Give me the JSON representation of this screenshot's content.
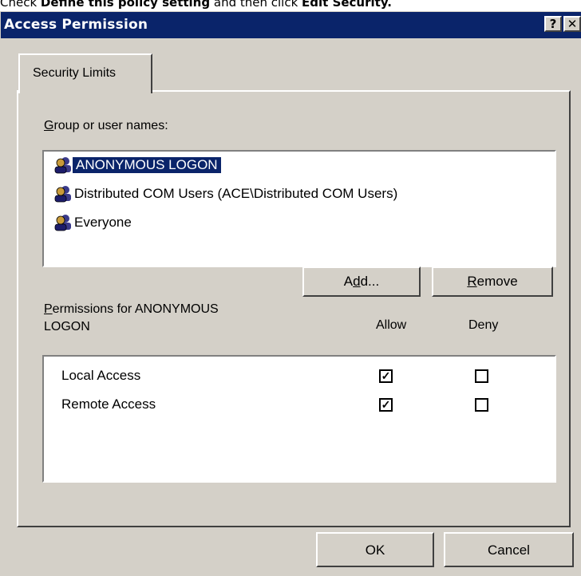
{
  "caption": {
    "prefix": "Check ",
    "bold1": "Define this policy setting",
    "middle": " and then click ",
    "bold2": "Edit Security."
  },
  "window": {
    "title": "Access Permission",
    "help_glyph": "?",
    "close_glyph": "✕"
  },
  "tabs": [
    {
      "label": "Security Limits"
    }
  ],
  "groups": {
    "label_accel": "G",
    "label_rest": "roup or user names:",
    "items": [
      {
        "name": "ANONYMOUS LOGON",
        "selected": true,
        "icon": "user-group-icon"
      },
      {
        "name": "Distributed COM Users (ACE\\Distributed COM Users)",
        "selected": false,
        "icon": "user-group-icon"
      },
      {
        "name": "Everyone",
        "selected": false,
        "icon": "user-group-icon"
      }
    ]
  },
  "buttons": {
    "add_pre": "A",
    "add_accel": "d",
    "add_post": "d...",
    "remove_accel": "R",
    "remove_post": "emove",
    "ok": "OK",
    "cancel": "Cancel"
  },
  "permissions": {
    "label_accel": "P",
    "label_line1_rest": "ermissions for ANONYMOUS",
    "label_line2": "LOGON",
    "allow_header": "Allow",
    "deny_header": "Deny",
    "rows": [
      {
        "name": "Local Access",
        "allow": true,
        "deny": false
      },
      {
        "name": "Remote Access",
        "allow": true,
        "deny": false
      }
    ]
  },
  "colors": {
    "titlebar": "#0a246a",
    "selection": "#0a246a",
    "face": "#d4d0c8"
  }
}
